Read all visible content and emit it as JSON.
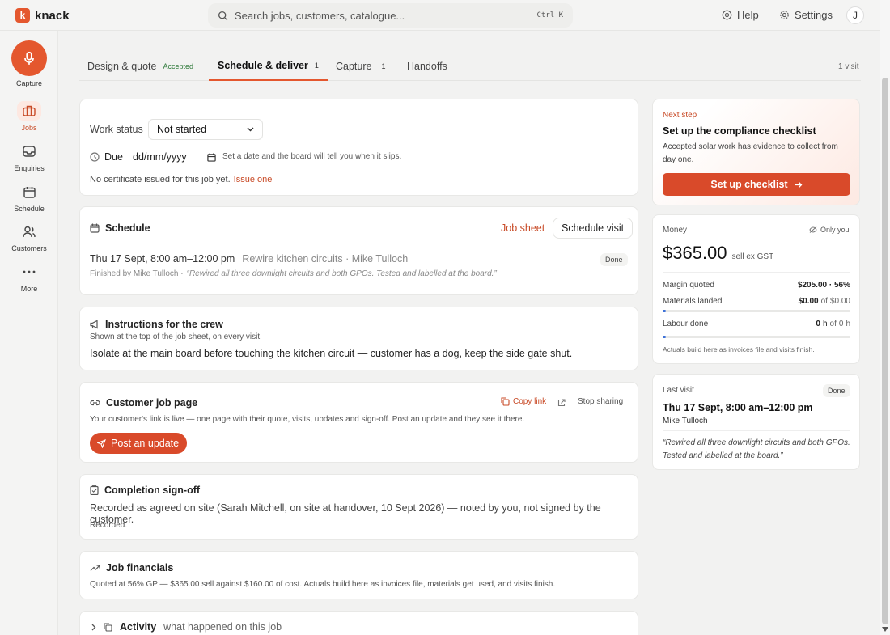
{
  "brand": {
    "name": "knack",
    "mark": "k",
    "color": "#e4572e"
  },
  "search": {
    "placeholder": "Search jobs, customers, catalogue...",
    "shortcut": "Ctrl K"
  },
  "topnav": {
    "help": "Help",
    "settings": "Settings",
    "avatar": "J"
  },
  "sidebar": {
    "capture": "Capture",
    "items": [
      {
        "label": "Jobs",
        "icon": "briefcase-icon",
        "active": true
      },
      {
        "label": "Enquiries",
        "icon": "inbox-icon"
      },
      {
        "label": "Schedule",
        "icon": "calendar-icon"
      },
      {
        "label": "Customers",
        "icon": "users-icon"
      },
      {
        "label": "More",
        "icon": "more-icon"
      }
    ]
  },
  "tabs": [
    {
      "label": "Design & quote",
      "badge": "Accepted"
    },
    {
      "label": "Schedule & deliver",
      "badge": "1"
    },
    {
      "label": "Capture",
      "badge": "1"
    },
    {
      "label": "Handoffs",
      "badge": ""
    }
  ],
  "visit_count": "1 visit",
  "work": {
    "status_label": "Work status",
    "status_value": "Not started",
    "due_label": "Due",
    "due_placeholder": "dd/mm/yyyy",
    "due_hint": "Set a date and the board will tell you when it slips.",
    "cert_text": "No certificate issued for this job yet.",
    "cert_link": "Issue one"
  },
  "schedule": {
    "title": "Schedule",
    "job_sheet": "Job sheet",
    "schedule_visit": "Schedule visit",
    "visit_when": "Thu 17 Sept, 8:00 am–12:00 pm",
    "visit_what": "Rewire kitchen circuits · Mike Tulloch",
    "visit_status": "Done",
    "finished_by": "Finished by Mike Tulloch ·",
    "note": "“Rewired all three downlight circuits and both GPOs. Tested and labelled at the board.”"
  },
  "crew": {
    "title": "Instructions for the crew",
    "sub": "Shown at the top of the job sheet, on every visit.",
    "text": "Isolate at the main board before touching the kitchen circuit — customer has a dog, keep the side gate shut."
  },
  "customer_page": {
    "title": "Customer job page",
    "copy": "Copy link",
    "stop": "Stop sharing",
    "desc": "Your customer's link is live — one page with their quote, visits, updates and sign-off. Post an update and they see it there.",
    "post": "Post an update"
  },
  "signoff": {
    "title": "Completion sign-off",
    "text": "Recorded as agreed on site (Sarah Mitchell, on site at handover, 10 Sept 2026) — noted by you, not signed by the customer.",
    "status": "Recorded."
  },
  "financials": {
    "title": "Job financials",
    "text": "Quoted at 56% GP — $365.00 sell against $160.00 of cost. Actuals build here as invoices file, materials get used, and visits finish."
  },
  "activity": {
    "title": "Activity",
    "sub": "what happened on this job"
  },
  "next_step": {
    "kicker": "Next step",
    "title": "Set up the compliance checklist",
    "desc": "Accepted solar work has evidence to collect from day one.",
    "button": "Set up checklist"
  },
  "money": {
    "title": "Money",
    "privacy": "Only you",
    "amount": "$365.00",
    "amount_sub": "sell ex GST",
    "margin_label": "Margin quoted",
    "margin_value": "$205.00 · 56%",
    "materials_label": "Materials landed",
    "materials_value": "$0.00",
    "materials_of": "of",
    "materials_total": "$0.00",
    "materials_progress": 0,
    "labour_label": "Labour done",
    "labour_value": "0",
    "labour_unit": "h",
    "labour_of": "of",
    "labour_total": "0",
    "labour_unit2": "h",
    "labour_progress": 0,
    "foot": "Actuals build here as invoices file and visits finish."
  },
  "last_visit": {
    "title": "Last visit",
    "status": "Done",
    "when": "Thu 17 Sept, 8:00 am–12:00 pm",
    "who": "Mike Tulloch",
    "note": "“Rewired all three downlight circuits and both GPOs. Tested and labelled at the board.”"
  }
}
